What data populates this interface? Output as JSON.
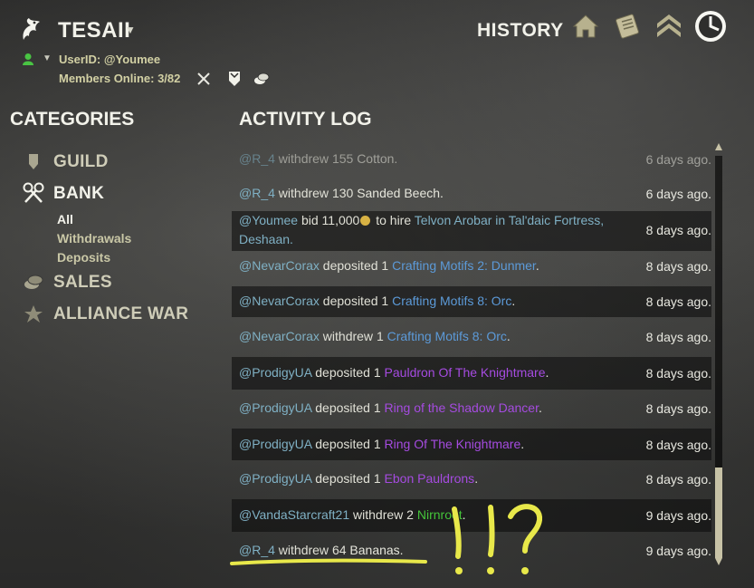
{
  "header": {
    "guild_name": "TESAII",
    "history_label": "HISTORY",
    "user_id": "UserID: @Youmee",
    "members_online": "Members Online: 3/82",
    "icons": [
      "home-icon",
      "scroll-icon",
      "rank-chevrons-icon",
      "guild-history-icon"
    ]
  },
  "categories": {
    "title": "CATEGORIES",
    "items": [
      {
        "label": "GUILD",
        "icon": "shield-icon"
      },
      {
        "label": "BANK",
        "icon": "keys-icon"
      },
      {
        "label": "SALES",
        "icon": "coins-icon"
      },
      {
        "label": "ALLIANCE WAR",
        "icon": "alliance-icon"
      }
    ],
    "bank_sub": [
      "All",
      "Withdrawals",
      "Deposits"
    ]
  },
  "log": {
    "title": "ACTIVITY LOG",
    "rows": [
      {
        "user": "@R_4",
        "action": "withdrew",
        "qty": "155",
        "item": "Cotton.",
        "item_color": "plain",
        "time": "6 days ago."
      },
      {
        "user": "@R_4",
        "action": "withdrew",
        "qty": "130",
        "item": "Sanded Beech.",
        "item_color": "plain",
        "time": "6 days ago."
      },
      {
        "user": "@Youmee",
        "action": "bid",
        "qty": "11,000",
        "item": "to hire",
        "extra": "Telvon Arobar in Tal'daic Fortress,",
        "extra2": "Deshaan.",
        "time": "8 days ago."
      },
      {
        "user": "@NevarCorax",
        "action": "deposited",
        "qty": "1",
        "item": "Crafting Motifs 2: Dunmer",
        "item_color": "blue",
        "time": "8 days ago."
      },
      {
        "user": "@NevarCorax",
        "action": "deposited",
        "qty": "1",
        "item": "Crafting Motifs 8: Orc",
        "item_color": "blue",
        "time": "8 days ago."
      },
      {
        "user": "@NevarCorax",
        "action": "withdrew",
        "qty": "1",
        "item": "Crafting Motifs 8: Orc",
        "item_color": "blue",
        "time": "8 days ago."
      },
      {
        "user": "@ProdigyUA",
        "action": "deposited",
        "qty": "1",
        "item": "Pauldron Of The Knightmare",
        "item_color": "purple",
        "time": "8 days ago."
      },
      {
        "user": "@ProdigyUA",
        "action": "deposited",
        "qty": "1",
        "item": "Ring of the Shadow Dancer",
        "item_color": "purple",
        "time": "8 days ago."
      },
      {
        "user": "@ProdigyUA",
        "action": "deposited",
        "qty": "1",
        "item": "Ring Of The Knightmare",
        "item_color": "purple",
        "time": "8 days ago."
      },
      {
        "user": "@ProdigyUA",
        "action": "deposited",
        "qty": "1",
        "item": "Ebon Pauldrons",
        "item_color": "purple",
        "time": "8 days ago."
      },
      {
        "user": "@VandaStarcraft21",
        "action": "withdrew",
        "qty": "2",
        "item": "Nirnroot",
        "item_color": "green",
        "time": "9 days ago."
      },
      {
        "user": "@R_4",
        "action": "withdrew",
        "qty": "64",
        "item": "Bananas.",
        "item_color": "plain",
        "time": "9 days ago."
      }
    ]
  },
  "annotation": {
    "text": "!!?",
    "color": "#e8e84a"
  },
  "colors": {
    "user": "#7fb0c4",
    "blue_item": "#5c9ad8",
    "purple_item": "#a54be0",
    "green_item": "#44c43a",
    "scroll_thumb": "#c7c2a6"
  }
}
